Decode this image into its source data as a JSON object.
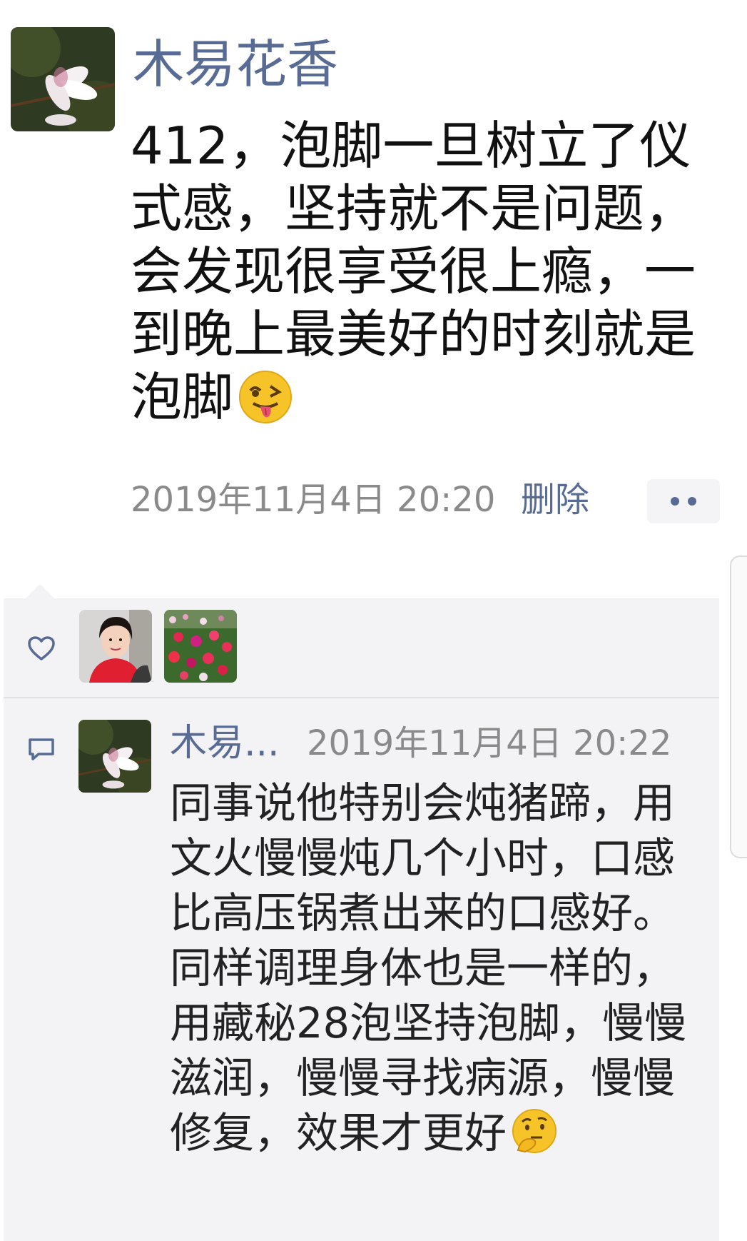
{
  "post": {
    "author": "木易花香",
    "avatar_icon": "magnolia-flower-avatar",
    "text": "412，泡脚一旦树立了仪式感，坚持就不是问题，会发现很享受很上瘾，一到晚上最美好的时刻就是泡脚",
    "emoji_icon": "winking-tongue-emoji",
    "time": "2019年11月4日 20:20",
    "delete_label": "删除",
    "more_icon": "more-dots-icon"
  },
  "likes": {
    "icon": "heart-outline-icon",
    "users": [
      {
        "avatar_icon": "woman-red-shirt-avatar"
      },
      {
        "avatar_icon": "flower-field-avatar"
      }
    ]
  },
  "comments": [
    {
      "icon": "comment-bubble-icon",
      "author": "木易...",
      "avatar_icon": "magnolia-flower-avatar",
      "time": "2019年11月4日 20:22",
      "text": "同事说他特别会炖猪蹄，用文火慢慢炖几个小时，口感比高压锅煮出来的口感好。同样调理身体也是一样的，用藏秘28泡坚持泡脚，慢慢滋润，慢慢寻找病源，慢慢修复，效果才更好",
      "emoji_icon": "thinking-face-emoji"
    }
  ],
  "colors": {
    "link": "#576b95",
    "meta": "#8a8a8a",
    "panel": "#f3f3f5"
  }
}
